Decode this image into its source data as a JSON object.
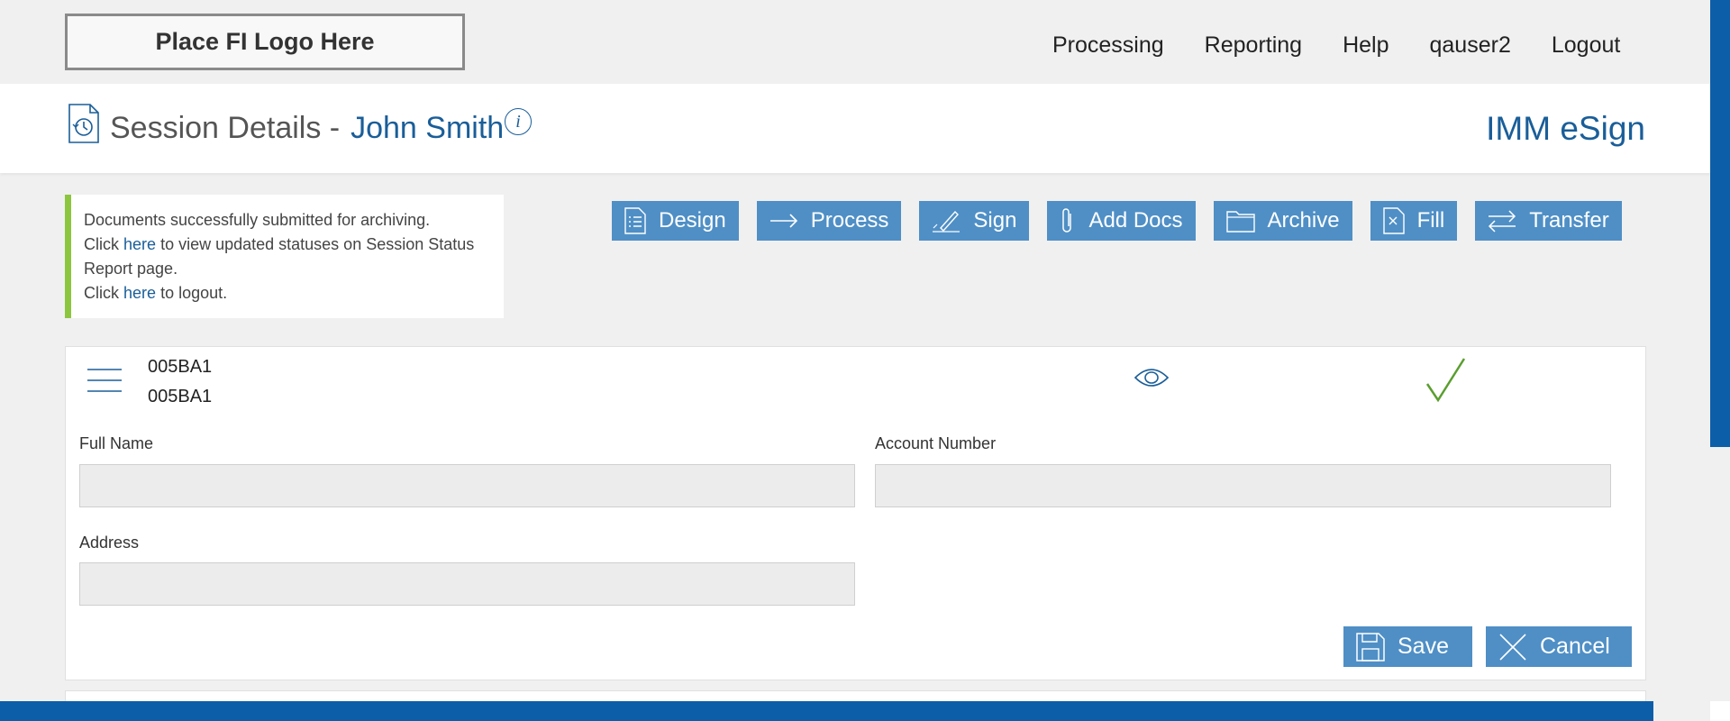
{
  "logo": {
    "text": "Place FI Logo Here"
  },
  "topnav": [
    "Processing",
    "Reporting",
    "Help",
    "qauser2",
    "Logout"
  ],
  "header": {
    "title": "Session Details -",
    "name": "John Smith",
    "brand": "IMM eSign"
  },
  "notice": {
    "line1": "Documents successfully submitted for archiving.",
    "click": "Click",
    "here": "here",
    "line2_rest": "to view updated statuses on Session Status Report page.",
    "line3_rest": "to logout."
  },
  "actions": [
    {
      "label": "Design",
      "icon": "document-list-icon"
    },
    {
      "label": "Process",
      "icon": "arrow-right-icon"
    },
    {
      "label": "Sign",
      "icon": "pen-icon"
    },
    {
      "label": "Add Docs",
      "icon": "paperclip-icon"
    },
    {
      "label": "Archive",
      "icon": "folder-icon"
    },
    {
      "label": "Fill",
      "icon": "form-file-icon"
    },
    {
      "label": "Transfer",
      "icon": "transfer-arrows-icon"
    }
  ],
  "document": {
    "code1": "005BA1",
    "code2": "005BA1"
  },
  "form": {
    "full_name_label": "Full Name",
    "full_name_value": "",
    "account_number_label": "Account Number",
    "account_number_value": "",
    "address_label": "Address",
    "address_value": ""
  },
  "buttons": {
    "save": "Save",
    "cancel": "Cancel"
  },
  "colors": {
    "accent": "#1a5e99",
    "button": "#4f8fc6",
    "success": "#8cc63f",
    "bar": "#0d5ea8"
  }
}
